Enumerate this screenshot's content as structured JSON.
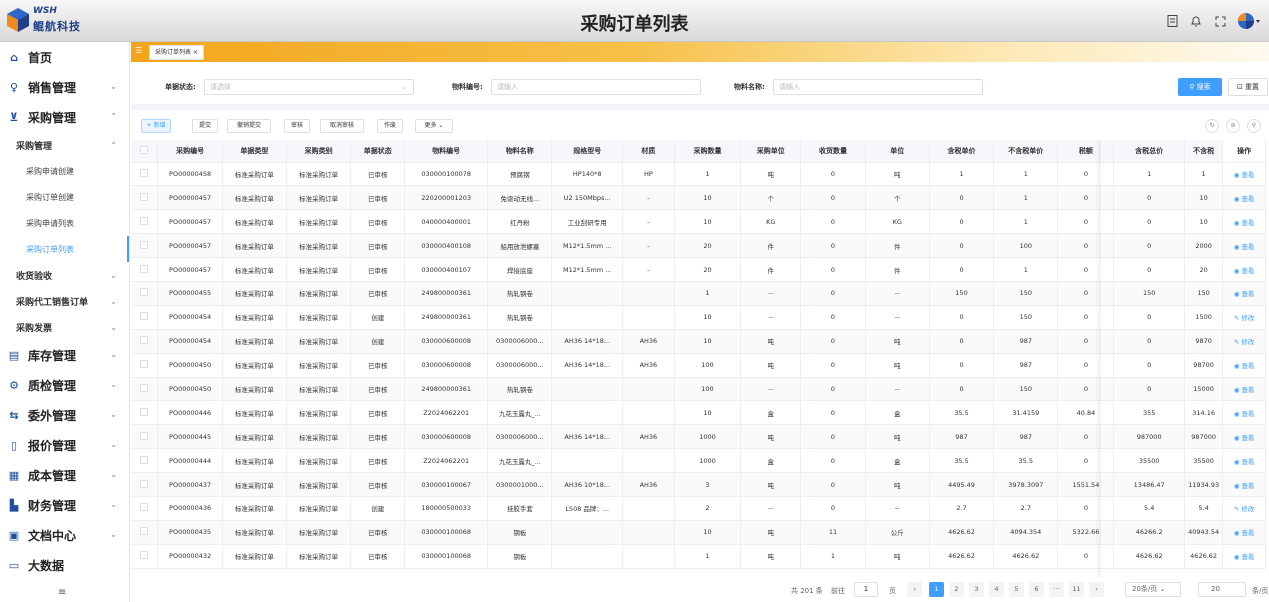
{
  "header": {
    "brand_en": "WSH",
    "brand_cn": "鲲航科技",
    "title": "采购订单列表"
  },
  "sidebar": {
    "items": [
      {
        "label": "首页",
        "icon": "home-icon",
        "glyph": "⌂",
        "chevron": ""
      },
      {
        "label": "销售管理",
        "icon": "trophy-icon",
        "glyph": "♀",
        "chevron": "⌄"
      },
      {
        "label": "采购管理",
        "icon": "cart-icon",
        "glyph": "⊻",
        "chevron": "⌃"
      }
    ],
    "purchase_group": {
      "label": "采购管理",
      "chevron": "⌃"
    },
    "purchase_leaves": [
      "采购申请创建",
      "采购订单创建",
      "采购申请列表",
      "采购订单列表"
    ],
    "sub_items": [
      {
        "label": "收货验收",
        "chevron": "⌄"
      },
      {
        "label": "采购代工销售订单",
        "chevron": "⌄"
      },
      {
        "label": "采购发票",
        "chevron": "⌄"
      }
    ],
    "bottom_items": [
      {
        "label": "库存管理",
        "icon": "inventory-icon",
        "glyph": "▤"
      },
      {
        "label": "质检管理",
        "icon": "quality-icon",
        "glyph": "⚙"
      },
      {
        "label": "委外管理",
        "icon": "outsource-icon",
        "glyph": "⇆"
      },
      {
        "label": "报价管理",
        "icon": "quote-icon",
        "glyph": "▯"
      },
      {
        "label": "成本管理",
        "icon": "cost-icon",
        "glyph": "▦"
      },
      {
        "label": "财务管理",
        "icon": "finance-icon",
        "glyph": "▙"
      },
      {
        "label": "文档中心",
        "icon": "document-icon",
        "glyph": "▣"
      },
      {
        "label": "大数据",
        "icon": "bigdata-icon",
        "glyph": "▭"
      }
    ],
    "chevron_down": "⌄",
    "collapse": "≡"
  },
  "tabs": {
    "home": "☰",
    "active": "采购订单列表 ×"
  },
  "search": {
    "status_label": "单据状态:",
    "status_placeholder": "请选择",
    "code_label": "物料编号:",
    "code_placeholder": "请输入",
    "name_label": "物料名称:",
    "name_placeholder": "请输入",
    "search_btn": "⚲ 搜索",
    "reset_btn": "⊡ 重置"
  },
  "toolbar": {
    "add": "+ 新增",
    "submit": "提交",
    "withdraw": "撤销提交",
    "audit": "审核",
    "cancel_audit": "取消审核",
    "void": "作废",
    "more": "更多 ⌄",
    "refresh": "↻",
    "filter": "⊜",
    "search": "⚲"
  },
  "table": {
    "columns": [
      "采购编号",
      "单据类型",
      "采购类别",
      "单据状态",
      "物料编号",
      "物料名称",
      "规格型号",
      "材质",
      "采购数量",
      "采购单位",
      "收货数量",
      "单位",
      "含税单价",
      "不含税单价",
      "税额",
      "含税总价",
      "不含税",
      "操作"
    ],
    "rows": [
      [
        "PO00000458",
        "标准采购订单",
        "标准采购订单",
        "已审核",
        "030000100078",
        "预腐钢",
        "HP140*8",
        "HP",
        "1",
        "吨",
        "0",
        "吨",
        "1",
        "1",
        "0",
        "1",
        "1",
        "查看"
      ],
      [
        "PO00000457",
        "标准采购订单",
        "标准采购订单",
        "已审核",
        "220200001203",
        "免驱动无线...",
        "U2 150Mbps...",
        "-",
        "10",
        "个",
        "0",
        "个",
        "0",
        "1",
        "0",
        "0",
        "10",
        "查看"
      ],
      [
        "PO00000457",
        "标准采购订单",
        "标准采购订单",
        "已审核",
        "040000400001",
        "红丹粉",
        "工业刮研专用",
        "-",
        "10",
        "KG",
        "0",
        "KG",
        "0",
        "1",
        "0",
        "0",
        "10",
        "查看"
      ],
      [
        "PO00000457",
        "标准采购订单",
        "标准采购订单",
        "已审核",
        "030000400108",
        "船用放泄螺塞",
        "M12*1.5mm ...",
        "-",
        "20",
        "件",
        "0",
        "件",
        "0",
        "100",
        "0",
        "0",
        "2000",
        "查看"
      ],
      [
        "PO00000457",
        "标准采购订单",
        "标准采购订单",
        "已审核",
        "030000400107",
        "焊接底座",
        "M12*1.5mm ...",
        "-",
        "20",
        "件",
        "0",
        "件",
        "0",
        "1",
        "0",
        "0",
        "20",
        "查看"
      ],
      [
        "PO00000455",
        "标准采购订单",
        "标准采购订单",
        "已审核",
        "249800000361",
        "热轧钢卷",
        "",
        "",
        "1",
        "--",
        "0",
        "--",
        "150",
        "150",
        "0",
        "150",
        "150",
        "查看"
      ],
      [
        "PO00000454",
        "标准采购订单",
        "标准采购订单",
        "创建",
        "249800000361",
        "热轧钢卷",
        "",
        "",
        "10",
        "--",
        "0",
        "--",
        "0",
        "150",
        "0",
        "0",
        "1500",
        "修改"
      ],
      [
        "PO00000454",
        "标准采购订单",
        "标准采购订单",
        "创建",
        "030000600008",
        "0300006000...",
        "AH36 14*18...",
        "AH36",
        "10",
        "吨",
        "0",
        "吨",
        "0",
        "987",
        "0",
        "0",
        "9870",
        "修改"
      ],
      [
        "PO00000450",
        "标准采购订单",
        "标准采购订单",
        "已审核",
        "030000600008",
        "0300006000...",
        "AH36 14*18...",
        "AH36",
        "100",
        "吨",
        "0",
        "吨",
        "0",
        "987",
        "0",
        "0",
        "98700",
        "查看"
      ],
      [
        "PO00000450",
        "标准采购订单",
        "标准采购订单",
        "已审核",
        "249800000361",
        "热轧钢卷",
        "",
        "",
        "100",
        "--",
        "0",
        "--",
        "0",
        "150",
        "0",
        "0",
        "15000",
        "查看"
      ],
      [
        "PO00000446",
        "标准采购订单",
        "标准采购订单",
        "已审核",
        "Z2024062201",
        "九花玉露丸_...",
        "",
        "",
        "10",
        "盒",
        "0",
        "盒",
        "35.5",
        "31.4159",
        "40.84",
        "355",
        "314.16",
        "查看"
      ],
      [
        "PO00000445",
        "标准采购订单",
        "标准采购订单",
        "已审核",
        "030000600008",
        "0300006000...",
        "AH36 14*18...",
        "AH36",
        "1000",
        "吨",
        "0",
        "吨",
        "987",
        "987",
        "0",
        "987000",
        "987000",
        "查看"
      ],
      [
        "PO00000444",
        "标准采购订单",
        "标准采购订单",
        "已审核",
        "Z2024062201",
        "九花玉露丸_...",
        "",
        "",
        "1000",
        "盒",
        "0",
        "盒",
        "35.5",
        "35.5",
        "0",
        "35500",
        "35500",
        "查看"
      ],
      [
        "PO00000437",
        "标准采购订单",
        "标准采购订单",
        "已审核",
        "030000100067",
        "0300001000...",
        "AH36 10*18...",
        "AH36",
        "3",
        "吨",
        "0",
        "吨",
        "4495.49",
        "3978.3097",
        "1551.54",
        "13486.47",
        "11934.93",
        "查看"
      ],
      [
        "PO00000436",
        "标准采购订单",
        "标准采购订单",
        "创建",
        "180000500033",
        "挂胶手套",
        "L508 品牌：...",
        "",
        "2",
        "--",
        "0",
        "--",
        "2.7",
        "2.7",
        "0",
        "5.4",
        "5.4",
        "修改"
      ],
      [
        "PO00000435",
        "标准采购订单",
        "标准采购订单",
        "已审核",
        "030000100068",
        "钢板",
        "",
        "",
        "10",
        "吨",
        "11",
        "公斤",
        "4626.62",
        "4094.354",
        "5322.66",
        "46266.2",
        "40943.54",
        "查看"
      ],
      [
        "PO00000432",
        "标准采购订单",
        "标准采购订单",
        "已审核",
        "030000100068",
        "钢板",
        "",
        "",
        "1",
        "吨",
        "1",
        "吨",
        "4626.62",
        "4626.62",
        "0",
        "4626.62",
        "4626.62",
        "查看"
      ]
    ]
  },
  "pagination": {
    "total": "共 201 条",
    "goto": "前往",
    "current_input": "1",
    "page_unit": "页",
    "prev": "‹",
    "pages": [
      "1",
      "2",
      "3",
      "4",
      "5",
      "6",
      "···",
      "11"
    ],
    "next": "›",
    "page_size": "20条/页 ⌄",
    "per_page_input": "20",
    "per_page_unit": "条/页"
  },
  "colors": {
    "accent": "#409eff",
    "tabs_gradient_start": "#f3a51a",
    "brand": "#1e3f8a"
  }
}
